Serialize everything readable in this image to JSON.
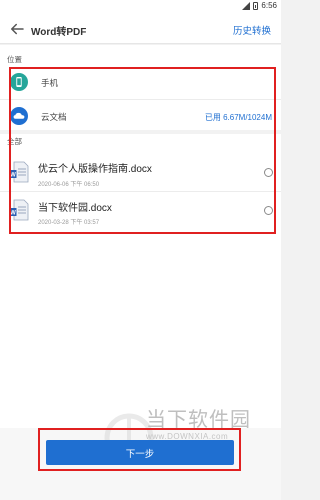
{
  "status_bar": {
    "time": "6:56"
  },
  "header": {
    "title": "Word转PDF",
    "history_label": "历史转换"
  },
  "location": {
    "section_label": "位置",
    "items": [
      {
        "label": "手机",
        "icon": "phone-icon",
        "value": ""
      },
      {
        "label": "云文档",
        "icon": "cloud-icon",
        "value": "已用 6.67M/1024M"
      }
    ]
  },
  "files": {
    "section_label": "全部",
    "items": [
      {
        "name": "优云个人版操作指南.docx",
        "meta": "2020-06-06 下午 06:50",
        "icon": "word-file-icon"
      },
      {
        "name": "当下软件园.docx",
        "meta": "2020-03-28 下午 03:57",
        "icon": "word-file-icon"
      }
    ]
  },
  "footer": {
    "next_label": "下一步"
  },
  "watermark": {
    "cn": "当下软件园",
    "url": "www.DOWNXIA.com"
  },
  "colors": {
    "accent": "#1f6fd1",
    "highlight": "#e02020"
  }
}
